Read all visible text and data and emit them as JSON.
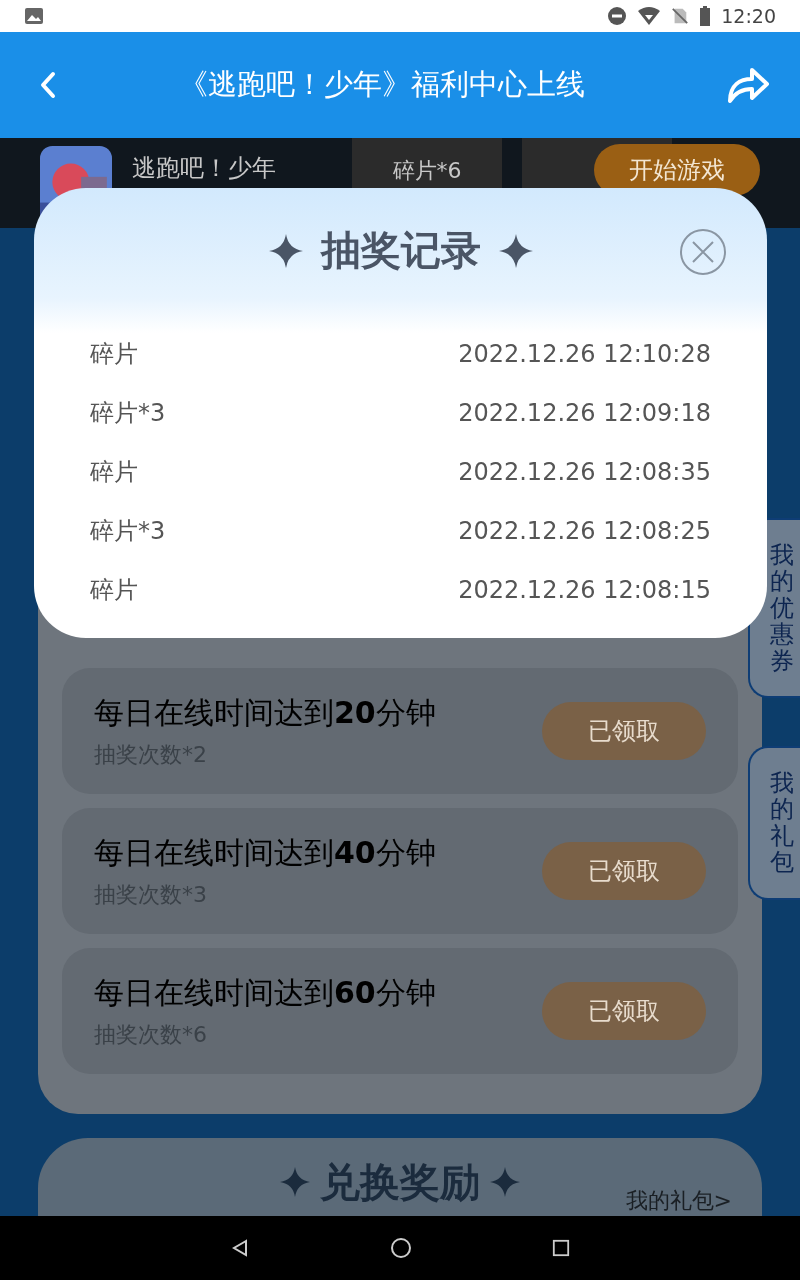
{
  "status_bar": {
    "time": "12:20"
  },
  "header": {
    "title": "《逃跑吧！少年》福利中心上线"
  },
  "game": {
    "name": "逃跑吧！少年",
    "items": [
      "碎片*6"
    ],
    "button": "开始游戏"
  },
  "side_tabs": [
    "我的优惠券",
    "我的礼包"
  ],
  "tasks": [
    {
      "title": "每日在线时间达到**20**分钟",
      "reward": "抽奖次数*2",
      "button": "已领取",
      "claimed": true
    },
    {
      "title": "每日在线时间达到**40**分钟",
      "reward": "抽奖次数*3",
      "button": "已领取",
      "claimed": true
    },
    {
      "title": "每日在线时间达到**60**分钟",
      "reward": "抽奖次数*6",
      "button": "已领取",
      "claimed": true
    }
  ],
  "exchange": {
    "title": "兑换奖励",
    "link": "我的礼包>"
  },
  "modal": {
    "title": "抽奖记录",
    "records": [
      {
        "item": "碎片",
        "time": "2022.12.26 12:10:28"
      },
      {
        "item": "碎片*3",
        "time": "2022.12.26 12:09:18"
      },
      {
        "item": "碎片",
        "time": "2022.12.26 12:08:35"
      },
      {
        "item": "碎片*3",
        "time": "2022.12.26 12:08:25"
      },
      {
        "item": "碎片",
        "time": "2022.12.26 12:08:15"
      }
    ]
  }
}
